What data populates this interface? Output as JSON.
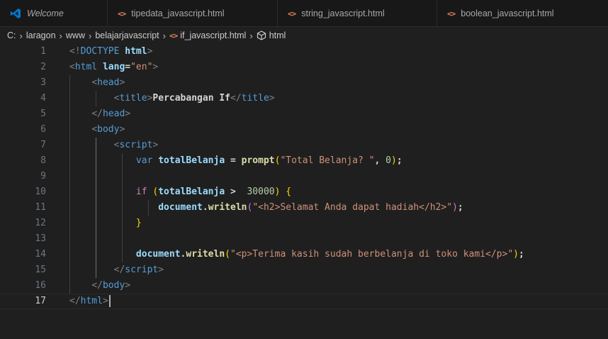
{
  "tabs": [
    {
      "label": "Welcome",
      "icon": "vscode-logo-icon",
      "italic": true
    },
    {
      "label": "tipedata_javascript.html",
      "icon": "html-code-icon"
    },
    {
      "label": "string_javascript.html",
      "icon": "html-code-icon"
    },
    {
      "label": "boolean_javascript.html",
      "icon": "html-code-icon"
    }
  ],
  "tab_code_glyph": "<>",
  "breadcrumb": {
    "items": [
      "C:",
      "laragon",
      "www",
      "belajarjavascript",
      "if_javascript.html",
      "html"
    ],
    "separator": "›"
  },
  "colors": {
    "background": "#1f1f1f",
    "tag": "#569cd6",
    "string": "#ce9178",
    "keyword_control": "#c586c0",
    "variable": "#9cdcfe",
    "function": "#dcdcaa",
    "number": "#b5cea8",
    "html_icon": "#e8855b",
    "vscode_icon": "#0078d4"
  },
  "editor": {
    "current_line": 17,
    "lines": [
      {
        "n": "1",
        "tokens": [
          [
            "punct",
            "<!"
          ],
          [
            "tag",
            "DOCTYPE "
          ],
          [
            "attr",
            "html"
          ],
          [
            "punct",
            ">"
          ]
        ]
      },
      {
        "n": "2",
        "tokens": [
          [
            "punct",
            "<"
          ],
          [
            "tag",
            "html "
          ],
          [
            "attr",
            "lang"
          ],
          [
            "text",
            "="
          ],
          [
            "str",
            "\"en\""
          ],
          [
            "punct",
            ">"
          ]
        ]
      },
      {
        "n": "3",
        "tokens": [
          [
            "text",
            "    "
          ],
          [
            "punct",
            "<"
          ],
          [
            "tag",
            "head"
          ],
          [
            "punct",
            ">"
          ]
        ]
      },
      {
        "n": "4",
        "tokens": [
          [
            "text",
            "        "
          ],
          [
            "punct",
            "<"
          ],
          [
            "tag",
            "title"
          ],
          [
            "punct",
            ">"
          ],
          [
            "text",
            "Percabangan If"
          ],
          [
            "punct",
            "</"
          ],
          [
            "tag",
            "title"
          ],
          [
            "punct",
            ">"
          ]
        ]
      },
      {
        "n": "5",
        "tokens": [
          [
            "text",
            "    "
          ],
          [
            "punct",
            "</"
          ],
          [
            "tag",
            "head"
          ],
          [
            "punct",
            ">"
          ]
        ]
      },
      {
        "n": "6",
        "tokens": [
          [
            "text",
            "    "
          ],
          [
            "punct",
            "<"
          ],
          [
            "tag",
            "body"
          ],
          [
            "punct",
            ">"
          ]
        ]
      },
      {
        "n": "7",
        "tokens": [
          [
            "text",
            "        "
          ],
          [
            "punct",
            "<"
          ],
          [
            "tag",
            "script"
          ],
          [
            "punct",
            ">"
          ]
        ]
      },
      {
        "n": "8",
        "tokens": [
          [
            "text",
            "            "
          ],
          [
            "kw",
            "var "
          ],
          [
            "var",
            "totalBelanja"
          ],
          [
            "text",
            " = "
          ],
          [
            "func",
            "prompt"
          ],
          [
            "bracket1",
            "("
          ],
          [
            "str",
            "\"Total Belanja? \""
          ],
          [
            "text",
            ", "
          ],
          [
            "num",
            "0"
          ],
          [
            "bracket1",
            ")"
          ],
          [
            "text",
            ";"
          ]
        ]
      },
      {
        "n": "9",
        "tokens": []
      },
      {
        "n": "10",
        "tokens": [
          [
            "text",
            "            "
          ],
          [
            "ctrl",
            "if "
          ],
          [
            "bracket1",
            "("
          ],
          [
            "var",
            "totalBelanja"
          ],
          [
            "text",
            " >  "
          ],
          [
            "num",
            "30000"
          ],
          [
            "bracket1",
            ")"
          ],
          [
            "text",
            " "
          ],
          [
            "bracket1",
            "{"
          ]
        ]
      },
      {
        "n": "11",
        "tokens": [
          [
            "text",
            "                "
          ],
          [
            "var",
            "document"
          ],
          [
            "text",
            "."
          ],
          [
            "func",
            "writeln"
          ],
          [
            "bracket2",
            "("
          ],
          [
            "str",
            "\"<h2>Selamat Anda dapat hadiah</h2>\""
          ],
          [
            "bracket2",
            ")"
          ],
          [
            "text",
            ";"
          ]
        ]
      },
      {
        "n": "12",
        "tokens": [
          [
            "text",
            "            "
          ],
          [
            "bracket1",
            "}"
          ]
        ]
      },
      {
        "n": "13",
        "tokens": []
      },
      {
        "n": "14",
        "tokens": [
          [
            "text",
            "            "
          ],
          [
            "var",
            "document"
          ],
          [
            "text",
            "."
          ],
          [
            "func",
            "writeln"
          ],
          [
            "bracket1",
            "("
          ],
          [
            "str",
            "\"<p>Terima kasih sudah berbelanja di toko kami</p>\""
          ],
          [
            "bracket1",
            ")"
          ],
          [
            "text",
            ";"
          ]
        ]
      },
      {
        "n": "15",
        "tokens": [
          [
            "text",
            "        "
          ],
          [
            "punct",
            "</"
          ],
          [
            "tag",
            "script"
          ],
          [
            "punct",
            ">"
          ]
        ]
      },
      {
        "n": "16",
        "tokens": [
          [
            "text",
            "    "
          ],
          [
            "punct",
            "</"
          ],
          [
            "tag",
            "body"
          ],
          [
            "punct",
            ">"
          ]
        ]
      },
      {
        "n": "17",
        "tokens": [
          [
            "punct",
            "</"
          ],
          [
            "tag",
            "html"
          ],
          [
            "punct",
            ">"
          ]
        ]
      }
    ]
  }
}
